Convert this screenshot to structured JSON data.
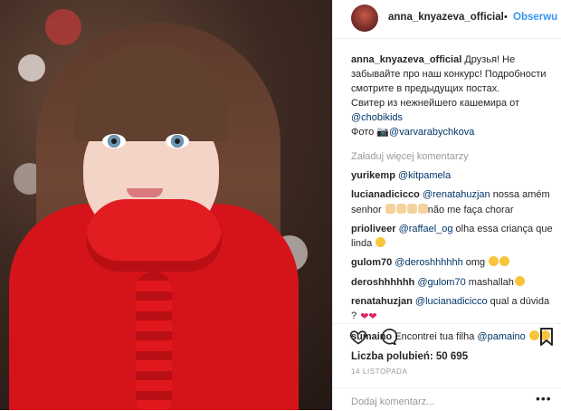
{
  "header": {
    "username": "anna_knyazeva_official",
    "separator": "•",
    "follow_label": "Obserwu"
  },
  "caption": {
    "username": "anna_knyazeva_official",
    "line1": "Друзья! Не забывайте про наш конкурс! Подробности смотрите в предыдущих постах.",
    "line2": "Свитер из нежнейшего кашемира от",
    "mention1": "@chobikids",
    "line3_prefix": "Фото",
    "mention2": "@varvarabychkova"
  },
  "load_more": "Załaduj więcej komentarzy",
  "comments": [
    {
      "user": "yurikemp",
      "mention": "@kitpamela",
      "text": ""
    },
    {
      "user": "lucianadicicco",
      "mention": "@renatahuzjan",
      "text": " nossa amém senhor ",
      "text2": "não me faça chorar"
    },
    {
      "user": "prioliveer",
      "mention": "@raffael_og",
      "text": " olha essa criança que linda "
    },
    {
      "user": "gulom70",
      "mention": "@deroshhhhhh",
      "text": " omg "
    },
    {
      "user": "deroshhhhhh",
      "mention": "@gulom70",
      "text": " mashallah"
    },
    {
      "user": "renatahuzjan",
      "mention": "@lucianadicicco",
      "text": " qual a dúvida ? "
    },
    {
      "user": "sumaino",
      "mention": "@pamaino",
      "text": "Encontrei tua filha ",
      "mention_after": true
    }
  ],
  "likes_text": "Liczba polubień: 50 695",
  "date": "14 LISTOPADA",
  "add_comment_placeholder": "Dodaj komentarz...",
  "more_label": "•••",
  "colors": {
    "accent": "#3897f0",
    "mention": "#003569",
    "sweater": "#d4141a"
  }
}
